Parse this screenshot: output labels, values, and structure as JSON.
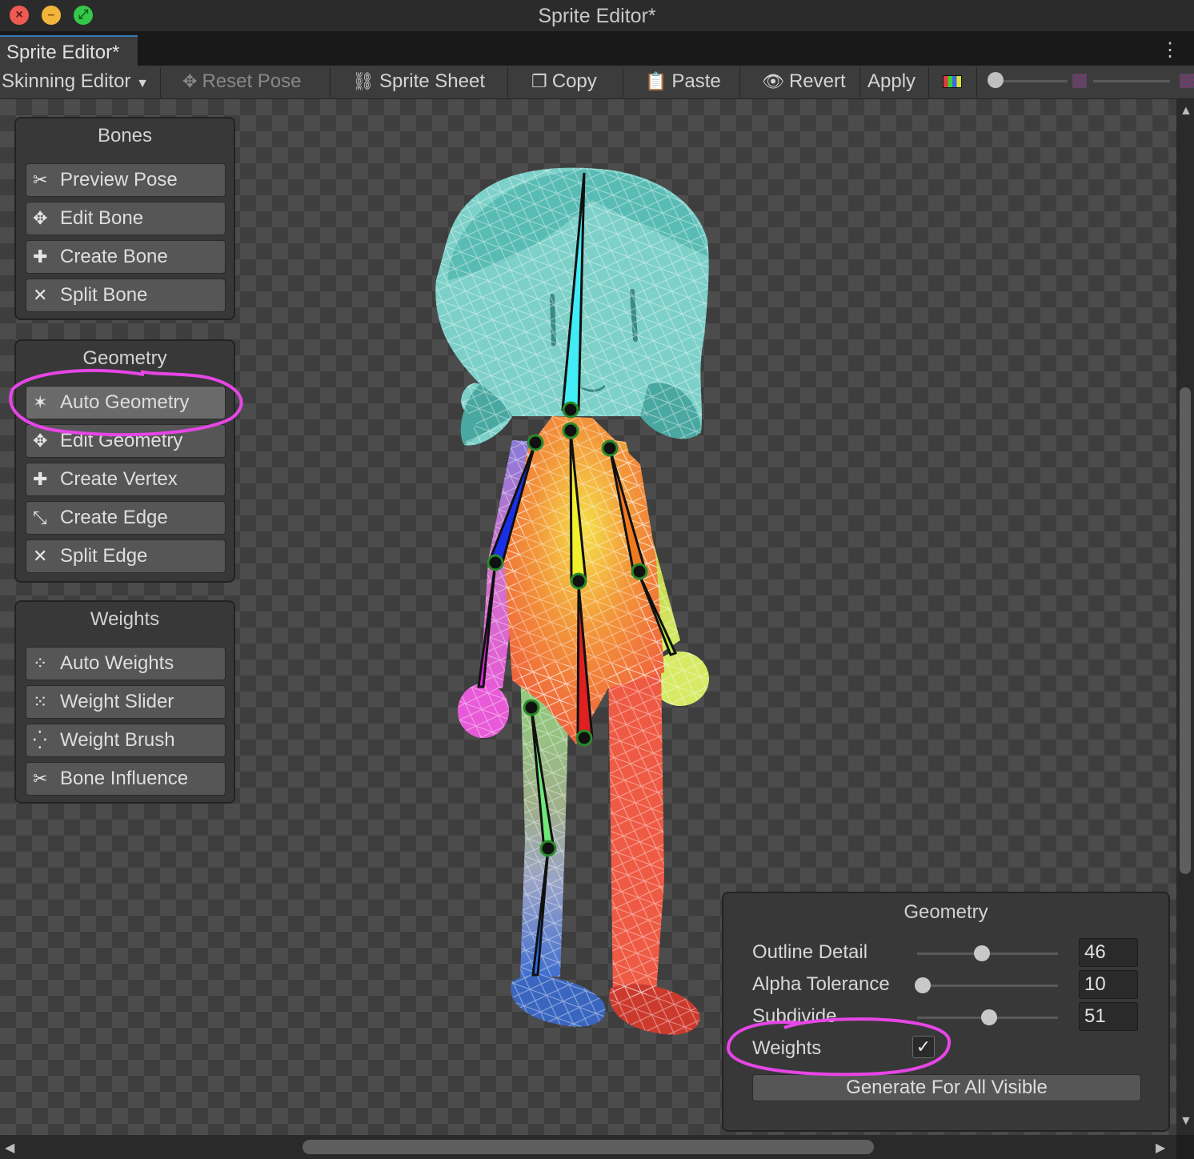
{
  "window": {
    "title": "Sprite Editor*",
    "tab_label": "Sprite Editor*"
  },
  "toolbar": {
    "mode_label": "Skinning Editor",
    "reset_pose": "Reset Pose",
    "sprite_sheet": "Sprite Sheet",
    "copy": "Copy",
    "paste": "Paste",
    "revert": "Revert",
    "apply": "Apply",
    "zoom_level": 0.0
  },
  "panels": {
    "bones": {
      "title": "Bones",
      "items": [
        "Preview Pose",
        "Edit Bone",
        "Create Bone",
        "Split Bone"
      ]
    },
    "geometry": {
      "title": "Geometry",
      "items": [
        "Auto Geometry",
        "Edit Geometry",
        "Create Vertex",
        "Create Edge",
        "Split Edge"
      ],
      "active": "Auto Geometry"
    },
    "weights": {
      "title": "Weights",
      "items": [
        "Auto Weights",
        "Weight Slider",
        "Weight Brush",
        "Bone Influence"
      ]
    }
  },
  "geometry_popup": {
    "title": "Geometry",
    "outline_detail": {
      "label": "Outline Detail",
      "value": "46",
      "slider_fraction": 0.46
    },
    "alpha_tolerance": {
      "label": "Alpha Tolerance",
      "value": "10",
      "slider_fraction": 0.04
    },
    "subdivide": {
      "label": "Subdivide",
      "value": "51",
      "slider_fraction": 0.51
    },
    "weights": {
      "label": "Weights",
      "checked": true
    },
    "generate_button": "Generate For All Visible"
  },
  "colors": {
    "accent": "#3a79bb",
    "annotation": "#e646e6",
    "head_mesh": "#7fd8d0"
  }
}
